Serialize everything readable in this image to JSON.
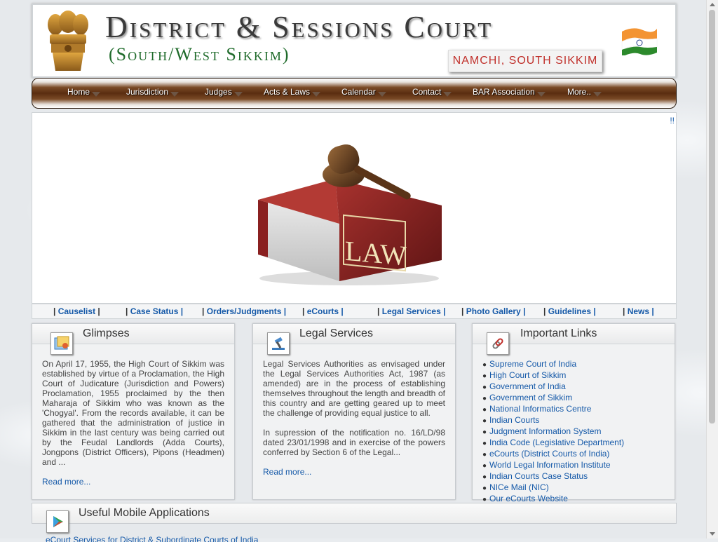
{
  "header": {
    "title": "District & Sessions Court",
    "subtitle": "(South/West Sikkim)",
    "location": "NAMCHI, SOUTH SIKKIM"
  },
  "nav": {
    "items": [
      {
        "label": "Home"
      },
      {
        "label": "Jurisdiction"
      },
      {
        "label": "Judges"
      },
      {
        "label": "Acts & Laws"
      },
      {
        "label": "Calendar"
      },
      {
        "label": "Contact"
      },
      {
        "label": "BAR Association"
      },
      {
        "label": "More.."
      }
    ]
  },
  "banner": {
    "marker": "!!",
    "image_label": "LAW"
  },
  "quicklinks": [
    {
      "label": "Causelist"
    },
    {
      "label": "Case Status"
    },
    {
      "label": "Orders/Judgments"
    },
    {
      "label": "eCourts"
    },
    {
      "label": "Legal Services"
    },
    {
      "label": "Photo Gallery"
    },
    {
      "label": "Guidelines"
    },
    {
      "label": "News"
    }
  ],
  "glimpses": {
    "title": "Glimpses",
    "text": "On April 17, 1955, the High Court of Sikkim was established by virtue of a Proclamation, the High Court of Judicature (Jurisdiction and Powers) Proclamation, 1955 proclaimed by the then Maharaja of Sikkim who was known as the 'Chogyal'. From the records available, it can be gathered that the administration of justice in Sikkim in the last century was being carried out by the Feudal Landlords (Adda Courts), Jongpons (District Officers), Pipons (Headmen) and ...",
    "read_more": "Read more..."
  },
  "legal_services": {
    "title": "Legal Services",
    "text1": "Legal Services Authorities as envisaged under the Legal Services Authorities Act, 1987 (as amended) are in the process of establishing themselves throughout the length and breadth of this country and are getting geared up to meet the challenge of providing equal justice to all.",
    "text2": "In supression of the notification no. 16/LD/98 dated 23/01/1998 and in exercise of the powers conferred by Section 6 of the Legal...",
    "read_more": "Read more..."
  },
  "important_links": {
    "title": "Important Links",
    "bullet": "●",
    "items": [
      {
        "label": "Supreme Court of India"
      },
      {
        "label": "High Court of Sikkim"
      },
      {
        "label": "Government of India"
      },
      {
        "label": "Government of Sikkim"
      },
      {
        "label": "National Informatics Centre"
      },
      {
        "label": "Indian Courts"
      },
      {
        "label": "Judgment Information System"
      },
      {
        "label": "India Code (Legislative Department)"
      },
      {
        "label": "eCourts (District Courts of India)"
      },
      {
        "label": "World Legal Information Institute"
      },
      {
        "label": "Indian Courts Case Status"
      },
      {
        "label": "NICe Mail (NIC)"
      },
      {
        "label": "Our eCourts Website"
      }
    ]
  },
  "mobile_apps": {
    "title": "Useful Mobile Applications",
    "peek": "eCourt Services for District & Subordinate Courts of India"
  },
  "colors": {
    "link": "#1559a8",
    "nav_brown": "#5a2d10",
    "location_red": "#c0302b",
    "subtitle_green": "#1f6b2b"
  }
}
